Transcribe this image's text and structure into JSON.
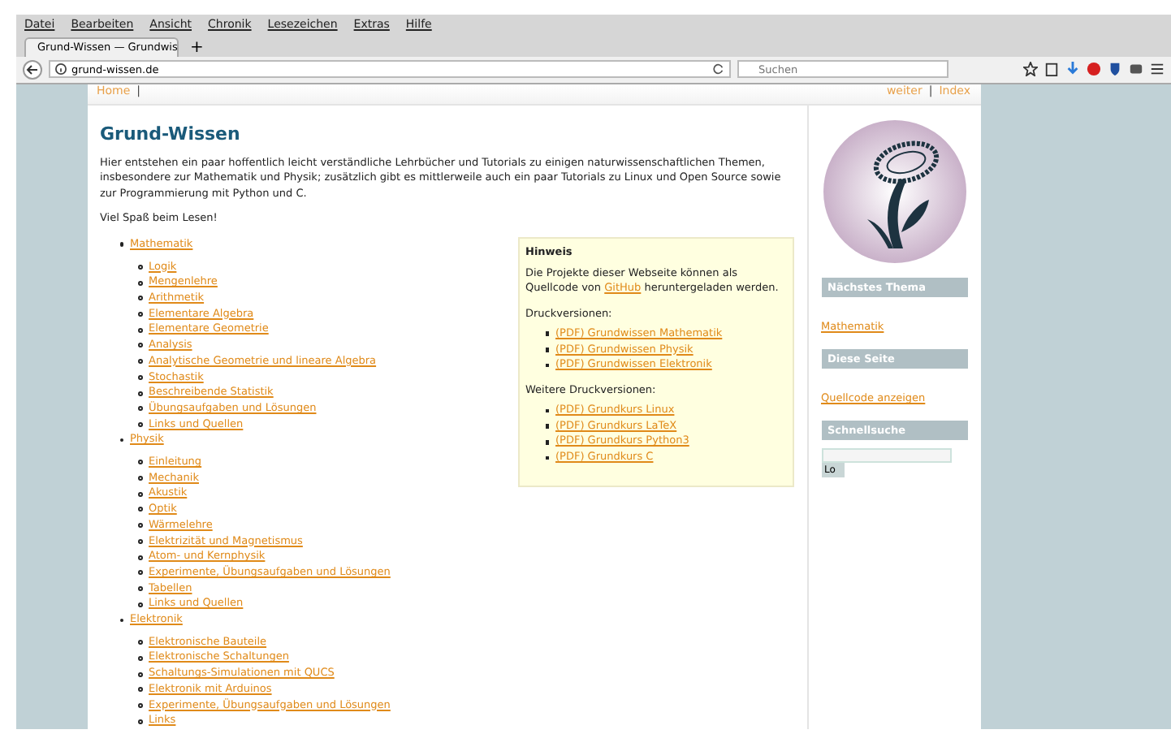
{
  "menu": [
    "Datei",
    "Bearbeiten",
    "Ansicht",
    "Chronik",
    "Lesezeichen",
    "Extras",
    "Hilfe"
  ],
  "tabs": [
    {
      "label": "Grund-Wissen — Grundwis",
      "selected": true
    }
  ],
  "new_tab": "+",
  "address": "grund-wissen.de",
  "search": {
    "placeholder": "Suchen"
  },
  "topnav": {
    "left": [
      "Home"
    ],
    "right": [
      "weiter",
      "Index"
    ],
    "separator": "|"
  },
  "title": "Grund-Wissen",
  "intro": "Hier entstehen ein paar hoffentlich leicht verständliche Lehrbücher und Tutorials zu einigen naturwissenschaftlichen Themen, insbesondere zur Mathematik und Physik; zusätzlich gibt es mittlerweile auch ein paar Tutorials zu Linux und Open Source sowie zur Programmierung mit Python und C.",
  "greeting": "Viel Spaß beim Lesen!",
  "toc": [
    {
      "label": "Mathematik",
      "children": [
        "Logik",
        "Mengenlehre",
        "Arithmetik",
        "Elementare Algebra",
        "Elementare Geometrie",
        "Analysis",
        "Analytische Geometrie und lineare Algebra",
        "Stochastik",
        "Beschreibende Statistik",
        "Übungsaufgaben und Lösungen",
        "Links und Quellen"
      ]
    },
    {
      "label": "Physik",
      "children": [
        "Einleitung",
        "Mechanik",
        "Akustik",
        "Optik",
        "Wärmelehre",
        "Elektrizität und Magnetismus",
        "Atom- und Kernphysik",
        "Experimente, Übungsaufgaben und Lösungen",
        "Tabellen",
        "Links und Quellen"
      ]
    },
    {
      "label": "Elektronik",
      "children": [
        "Elektronische Bauteile",
        "Elektronische Schaltungen",
        "Schaltungs-Simulationen mit QUCS",
        "Elektronik mit Arduinos",
        "Experimente, Übungsaufgaben und Lösungen",
        "Links"
      ]
    }
  ],
  "hint": {
    "title": "Hinweis",
    "text_before": "Die Projekte dieser Webseite können als Quellcode von",
    "link": "GitHub",
    "text_after": "heruntergeladen werden.",
    "sections": [
      {
        "heading": "Druckversionen:",
        "links": [
          "(PDF) Grundwissen Mathematik",
          "(PDF) Grundwissen Physik",
          "(PDF) Grundwissen Elektronik"
        ]
      },
      {
        "heading": "Weitere Druckversionen:",
        "links": [
          "(PDF) Grundkurs Linux",
          "(PDF) Grundkurs LaTeX",
          "(PDF) Grundkurs Python3",
          "(PDF) Grundkurs C"
        ]
      }
    ]
  },
  "sidebar": [
    {
      "kind": "link",
      "heading": "Nächstes Thema",
      "link": "Mathematik"
    },
    {
      "kind": "link",
      "heading": "Diese Seite",
      "link": "Quellcode anzeigen"
    },
    {
      "kind": "search",
      "heading": "Schnellsuche",
      "button": "Lo"
    }
  ]
}
